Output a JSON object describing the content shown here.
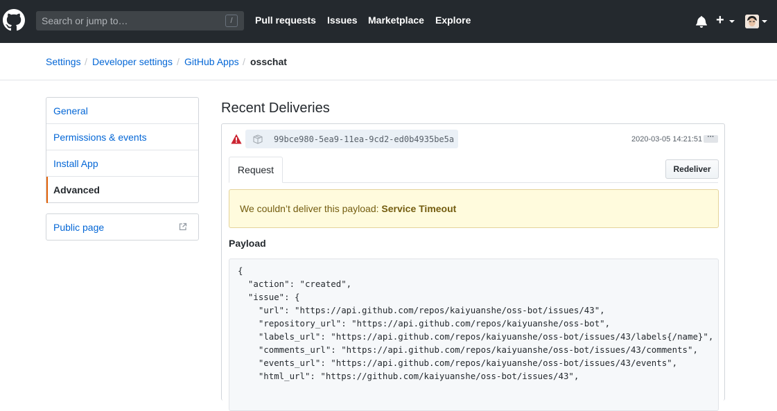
{
  "header": {
    "search_placeholder": "Search or jump to…",
    "search_shortcut": "/",
    "nav": [
      "Pull requests",
      "Issues",
      "Marketplace",
      "Explore"
    ],
    "plus_label": "+"
  },
  "breadcrumb": {
    "items": [
      "Settings",
      "Developer settings",
      "GitHub Apps",
      "osschat"
    ],
    "separator": "/"
  },
  "sidebar": {
    "items": [
      {
        "label": "General"
      },
      {
        "label": "Permissions & events"
      },
      {
        "label": "Install App"
      },
      {
        "label": "Advanced"
      }
    ],
    "public_page": "Public page"
  },
  "main": {
    "title": "Recent Deliveries",
    "delivery": {
      "guid": "99bce980-5ea9-11ea-9cd2-ed0b4935be5a",
      "timestamp": "2020-03-05 14:21:51",
      "more_label": "···",
      "tab_request": "Request",
      "redeliver": "Redeliver",
      "flash_text": "We couldn’t deliver this payload: ",
      "flash_reason": "Service Timeout",
      "payload_label": "Payload",
      "payload_lines": [
        "{",
        "  \"action\": \"created\",",
        "  \"issue\": {",
        "    \"url\": \"https://api.github.com/repos/kaiyuanshe/oss-bot/issues/43\",",
        "    \"repository_url\": \"https://api.github.com/repos/kaiyuanshe/oss-bot\",",
        "    \"labels_url\": \"https://api.github.com/repos/kaiyuanshe/oss-bot/issues/43/labels{/name}\",",
        "    \"comments_url\": \"https://api.github.com/repos/kaiyuanshe/oss-bot/issues/43/comments\",",
        "    \"events_url\": \"https://api.github.com/repos/kaiyuanshe/oss-bot/issues/43/events\",",
        "    \"html_url\": \"https://github.com/kaiyuanshe/oss-bot/issues/43\","
      ]
    }
  },
  "colors": {
    "header_bg": "#24292e",
    "link": "#0366d6",
    "warning_bg": "#fffbdd",
    "warning_text": "#735c0f",
    "selected_accent": "#e36209",
    "alert_red": "#cb2431"
  },
  "icons": [
    "github-logo-icon",
    "bell-icon",
    "plus-icon",
    "external-link-icon",
    "alert-icon",
    "package-icon"
  ]
}
